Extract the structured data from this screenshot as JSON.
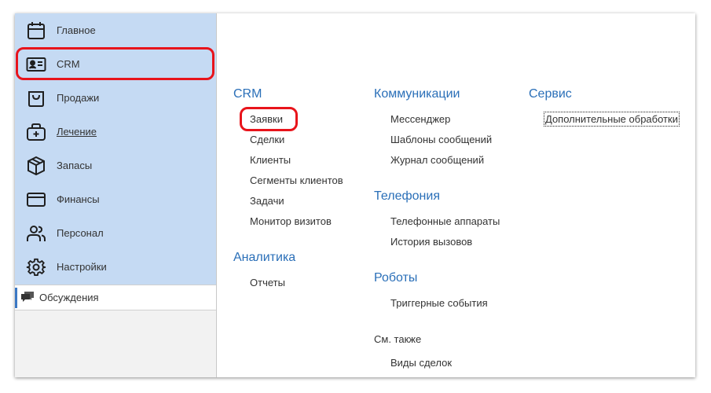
{
  "sidebar": {
    "items": [
      {
        "label": "Главное",
        "icon": "calendar-icon"
      },
      {
        "label": "CRM",
        "icon": "contact-card-icon"
      },
      {
        "label": "Продажи",
        "icon": "shopping-bag-icon"
      },
      {
        "label": "Лечение",
        "icon": "medical-bag-icon"
      },
      {
        "label": "Запасы",
        "icon": "box-icon"
      },
      {
        "label": "Финансы",
        "icon": "credit-card-icon"
      },
      {
        "label": "Персонал",
        "icon": "users-icon"
      },
      {
        "label": "Настройки",
        "icon": "gear-icon"
      }
    ],
    "discussions": {
      "label": "Обсуждения",
      "icon": "chat-icon"
    }
  },
  "main": {
    "crm": {
      "title": "CRM",
      "links": [
        "Заявки",
        "Сделки",
        "Клиенты",
        "Сегменты клиентов",
        "Задачи",
        "Монитор визитов"
      ]
    },
    "analytics": {
      "title": "Аналитика",
      "links": [
        "Отчеты"
      ]
    },
    "communications": {
      "title": "Коммуникации",
      "links": [
        "Мессенджер",
        "Шаблоны сообщений",
        "Журнал сообщений"
      ]
    },
    "telephony": {
      "title": "Телефония",
      "links": [
        "Телефонные аппараты",
        "История вызовов"
      ]
    },
    "robots": {
      "title": "Роботы",
      "links": [
        "Триггерные события"
      ]
    },
    "see_also": {
      "title": "См. также",
      "links": [
        "Виды сделок"
      ]
    },
    "service": {
      "title": "Сервис",
      "links": [
        "Дополнительные обработки"
      ]
    }
  },
  "colors": {
    "sidebar_bg": "#c5daf3",
    "accent_blue": "#2a6fb8",
    "highlight_red": "#e8141b"
  }
}
